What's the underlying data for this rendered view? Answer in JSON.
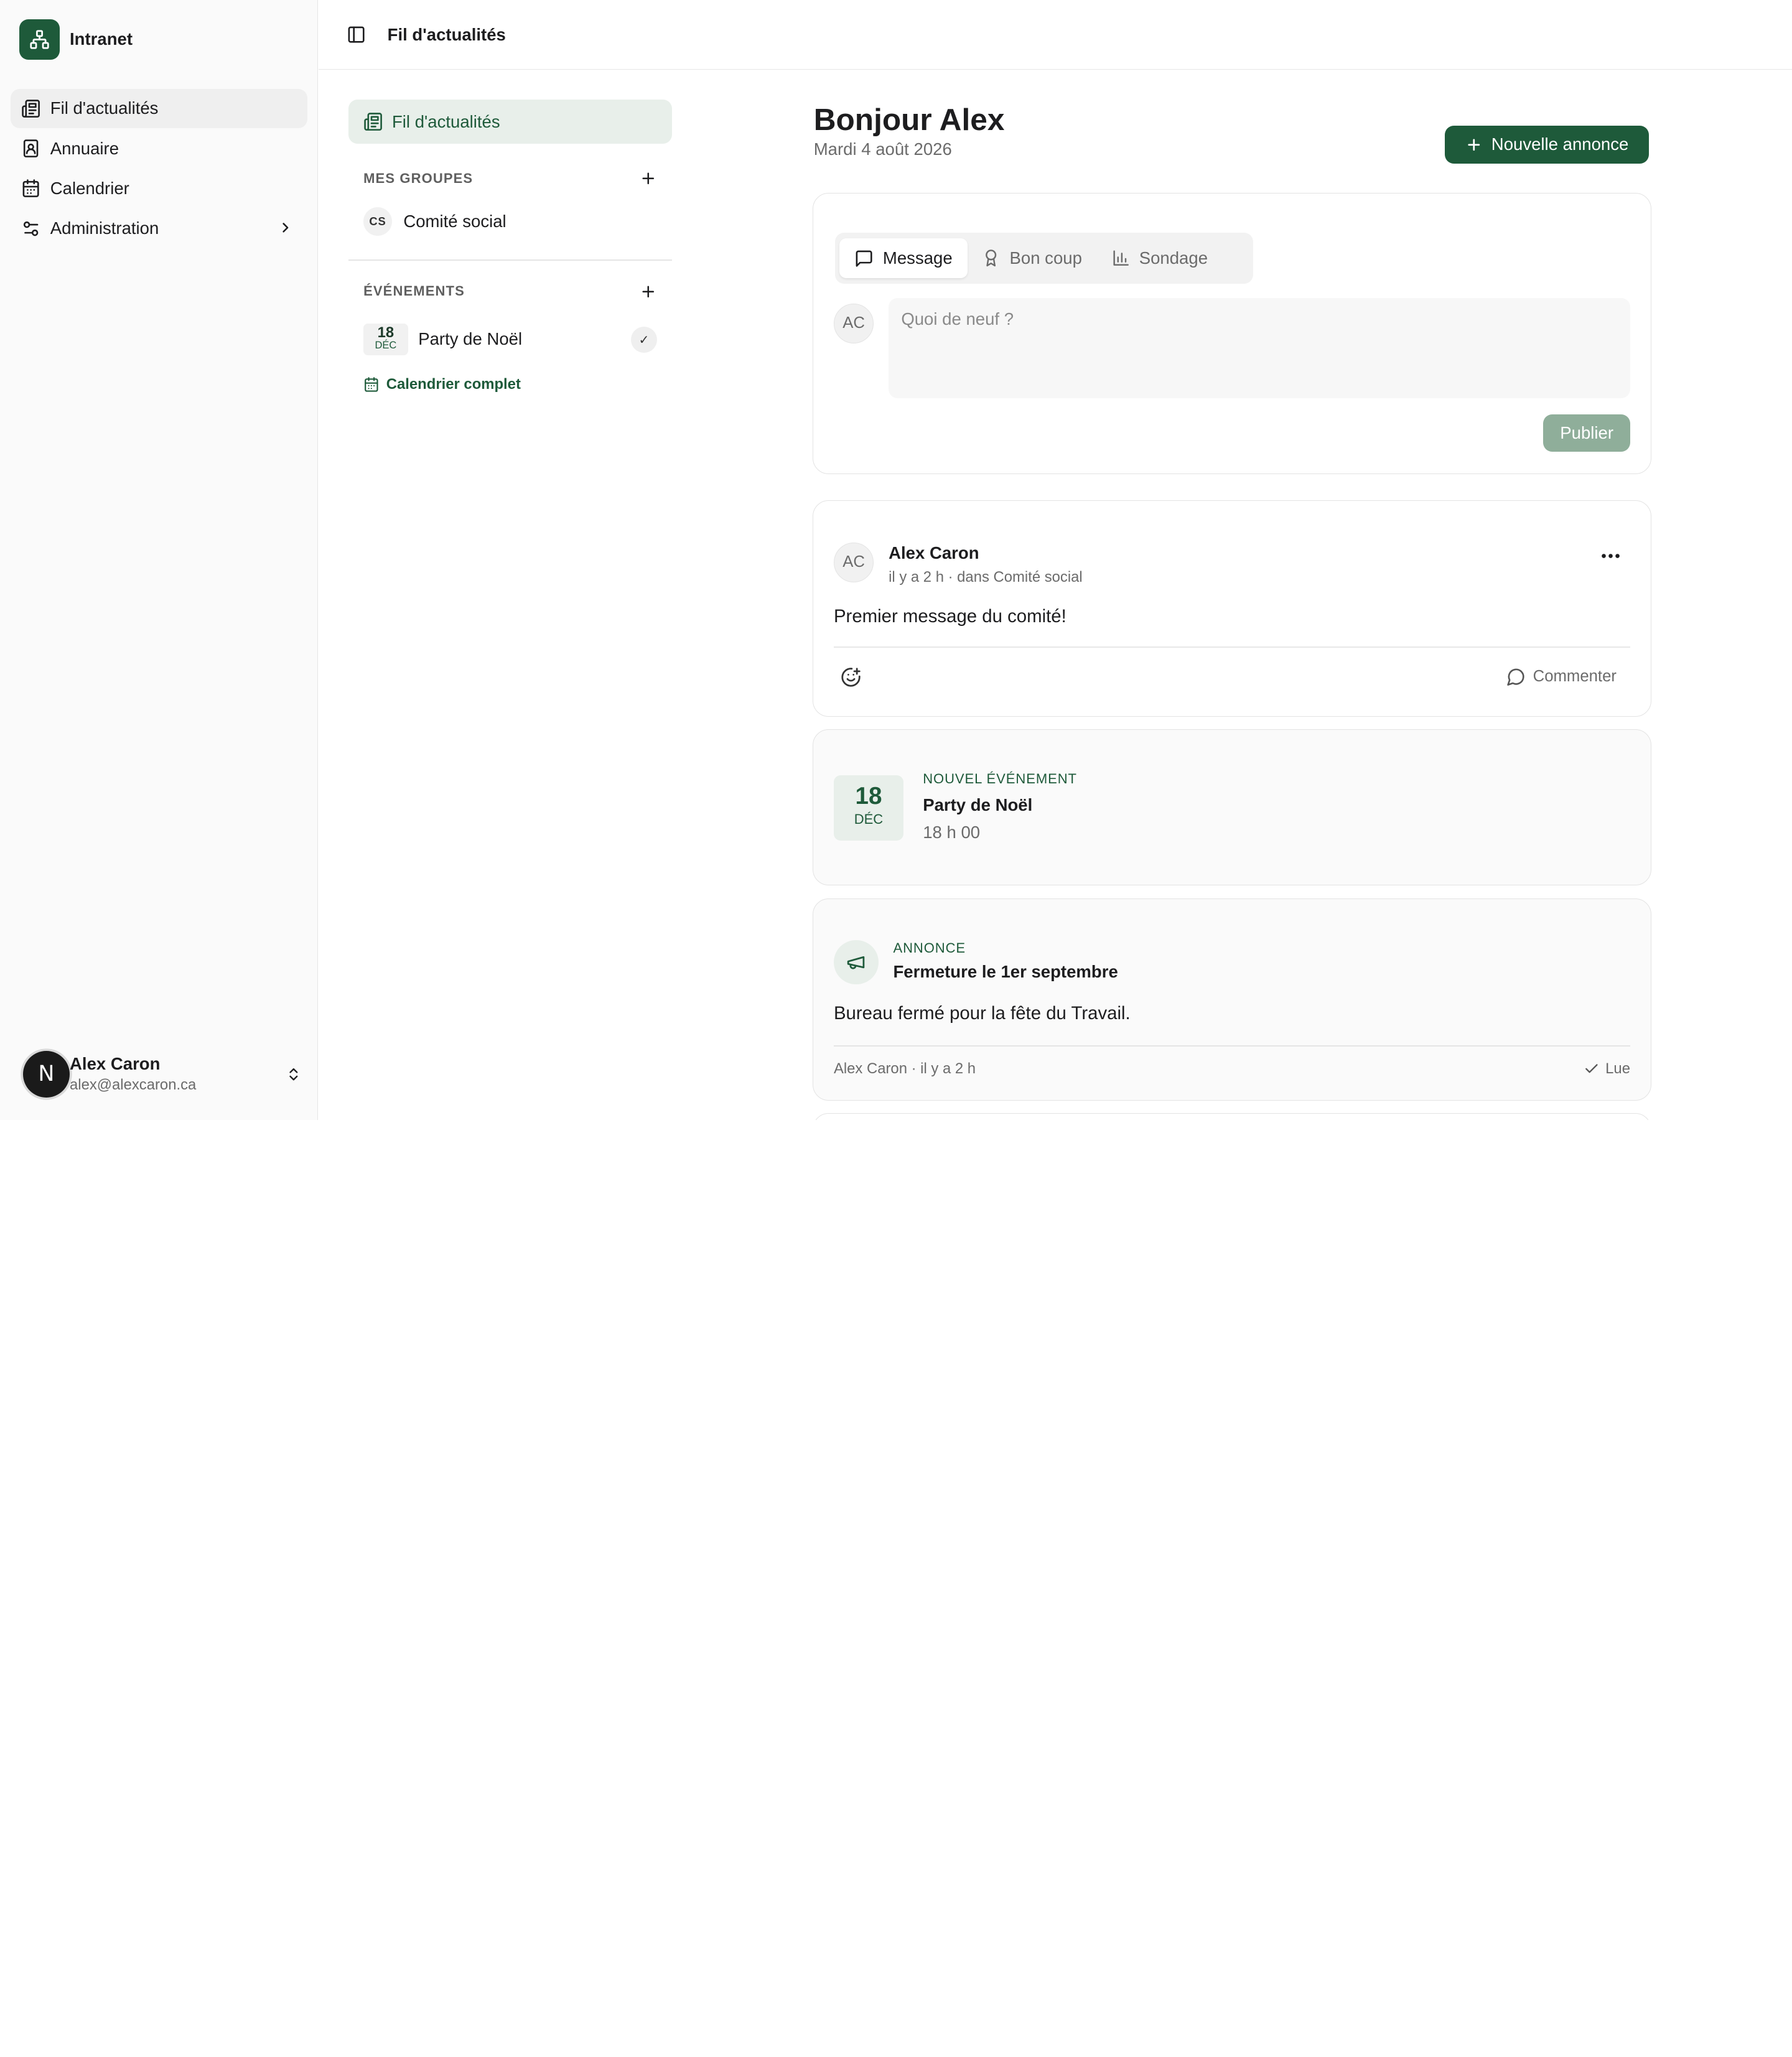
{
  "sidebar": {
    "brand": "Intranet",
    "items": [
      {
        "label": "Fil d'actualités",
        "icon": "newspaper-icon"
      },
      {
        "label": "Annuaire",
        "icon": "contact-book-icon"
      },
      {
        "label": "Calendrier",
        "icon": "calendar-icon"
      },
      {
        "label": "Administration",
        "icon": "settings-sliders-icon"
      }
    ],
    "user": {
      "initial": "N",
      "name": "Alex Caron",
      "email": "alex@alexcaron.ca"
    }
  },
  "topbar": {
    "title": "Fil d'actualités"
  },
  "panel": {
    "feed_label": "Fil d'actualités",
    "groups_heading": "MES GROUPES",
    "groups": [
      {
        "badge": "CS",
        "name": "Comité social"
      }
    ],
    "events_heading": "ÉVÉNEMENTS",
    "events": [
      {
        "day": "18",
        "month": "DÉC",
        "name": "Party de Noël",
        "rsvp": "✓"
      }
    ],
    "calendar_link": "Calendrier complet"
  },
  "main": {
    "greeting": "Bonjour Alex",
    "date": "Mardi 4 août 2026",
    "new_button": "Nouvelle annonce",
    "composer": {
      "tabs": [
        "Message",
        "Bon coup",
        "Sondage"
      ],
      "avatar": "AC",
      "placeholder": "Quoi de neuf ?",
      "publish": "Publier"
    },
    "post": {
      "avatar": "AC",
      "author": "Alex Caron",
      "meta": "il y a 2 h · dans Comité social",
      "body": "Premier message du comité!",
      "comment": "Commenter"
    },
    "event_card": {
      "day": "18",
      "month": "DÉC",
      "kicker": "NOUVEL ÉVÉNEMENT",
      "title": "Party de Noël",
      "time": "18 h 00"
    },
    "announcement": {
      "kicker": "ANNONCE",
      "title": "Fermeture le 1er septembre",
      "body": "Bureau fermé pour la fête du Travail.",
      "meta": "Alex Caron · il y a 2 h",
      "read": "Lue"
    }
  },
  "colors": {
    "accent": "#1e5a3a",
    "accent_soft": "#e8efea",
    "publish_disabled": "#8fae9a"
  }
}
